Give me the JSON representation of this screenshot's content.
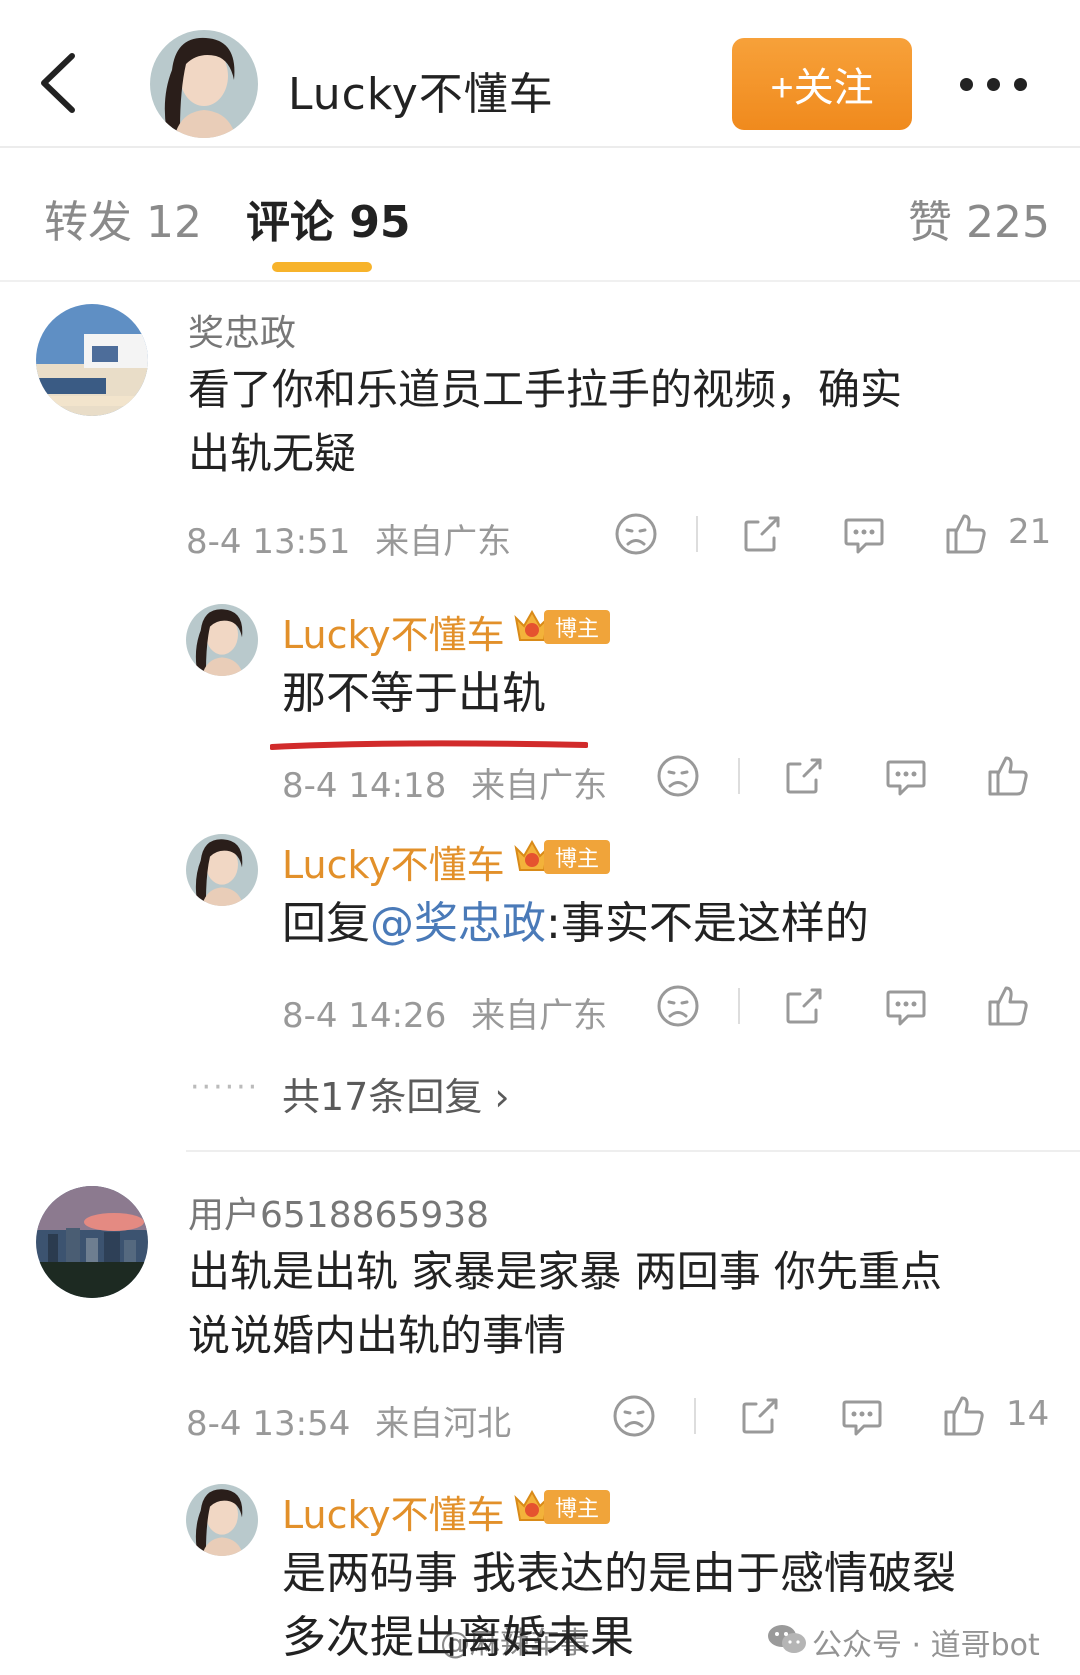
{
  "header": {
    "title": "Lucky不懂车",
    "follow_label": "+关注"
  },
  "tabs": [
    {
      "label": "转发 12"
    },
    {
      "label": "评论 95"
    },
    {
      "label": "赞 225"
    }
  ],
  "comments": [
    {
      "user": "奖忠政",
      "text_line1": "看了你和乐道员工手拉手的视频，确实",
      "text_line2": "出轨无疑",
      "time": "8-4 13:51",
      "location": "来自广东",
      "likes": "21",
      "replies": [
        {
          "user": "Lucky不懂车",
          "badge": "博主",
          "text": "那不等于出轨",
          "time": "8-4 14:18",
          "location": "来自广东"
        },
        {
          "user": "Lucky不懂车",
          "badge": "博主",
          "text_prefix": "回复",
          "mention": "@奖忠政",
          "text_suffix": ":事实不是这样的",
          "time": "8-4 14:26",
          "location": "来自广东"
        }
      ],
      "replies_more": "共17条回复 ›"
    },
    {
      "user": "用户6518865938",
      "text_line1": "出轨是出轨 家暴是家暴 两回事 你先重点",
      "text_line2": "说说婚内出轨的事情",
      "time": "8-4 13:54",
      "location": "来自河北",
      "likes": "14",
      "replies": [
        {
          "user": "Lucky不懂车",
          "badge": "博主",
          "text_line1": "是两码事 我表达的是由于感情破裂",
          "text_line2": "多次提出离婚未果"
        }
      ]
    }
  ],
  "watermarks": {
    "weibo": "@麻辣车事",
    "wechat": "公众号 · 道哥bot"
  },
  "colors": {
    "accent_orange": "#f08a1d",
    "blogger_name": "#e2902a",
    "mention_blue": "#4a7ab8",
    "tab_underline": "#f7b32b"
  }
}
